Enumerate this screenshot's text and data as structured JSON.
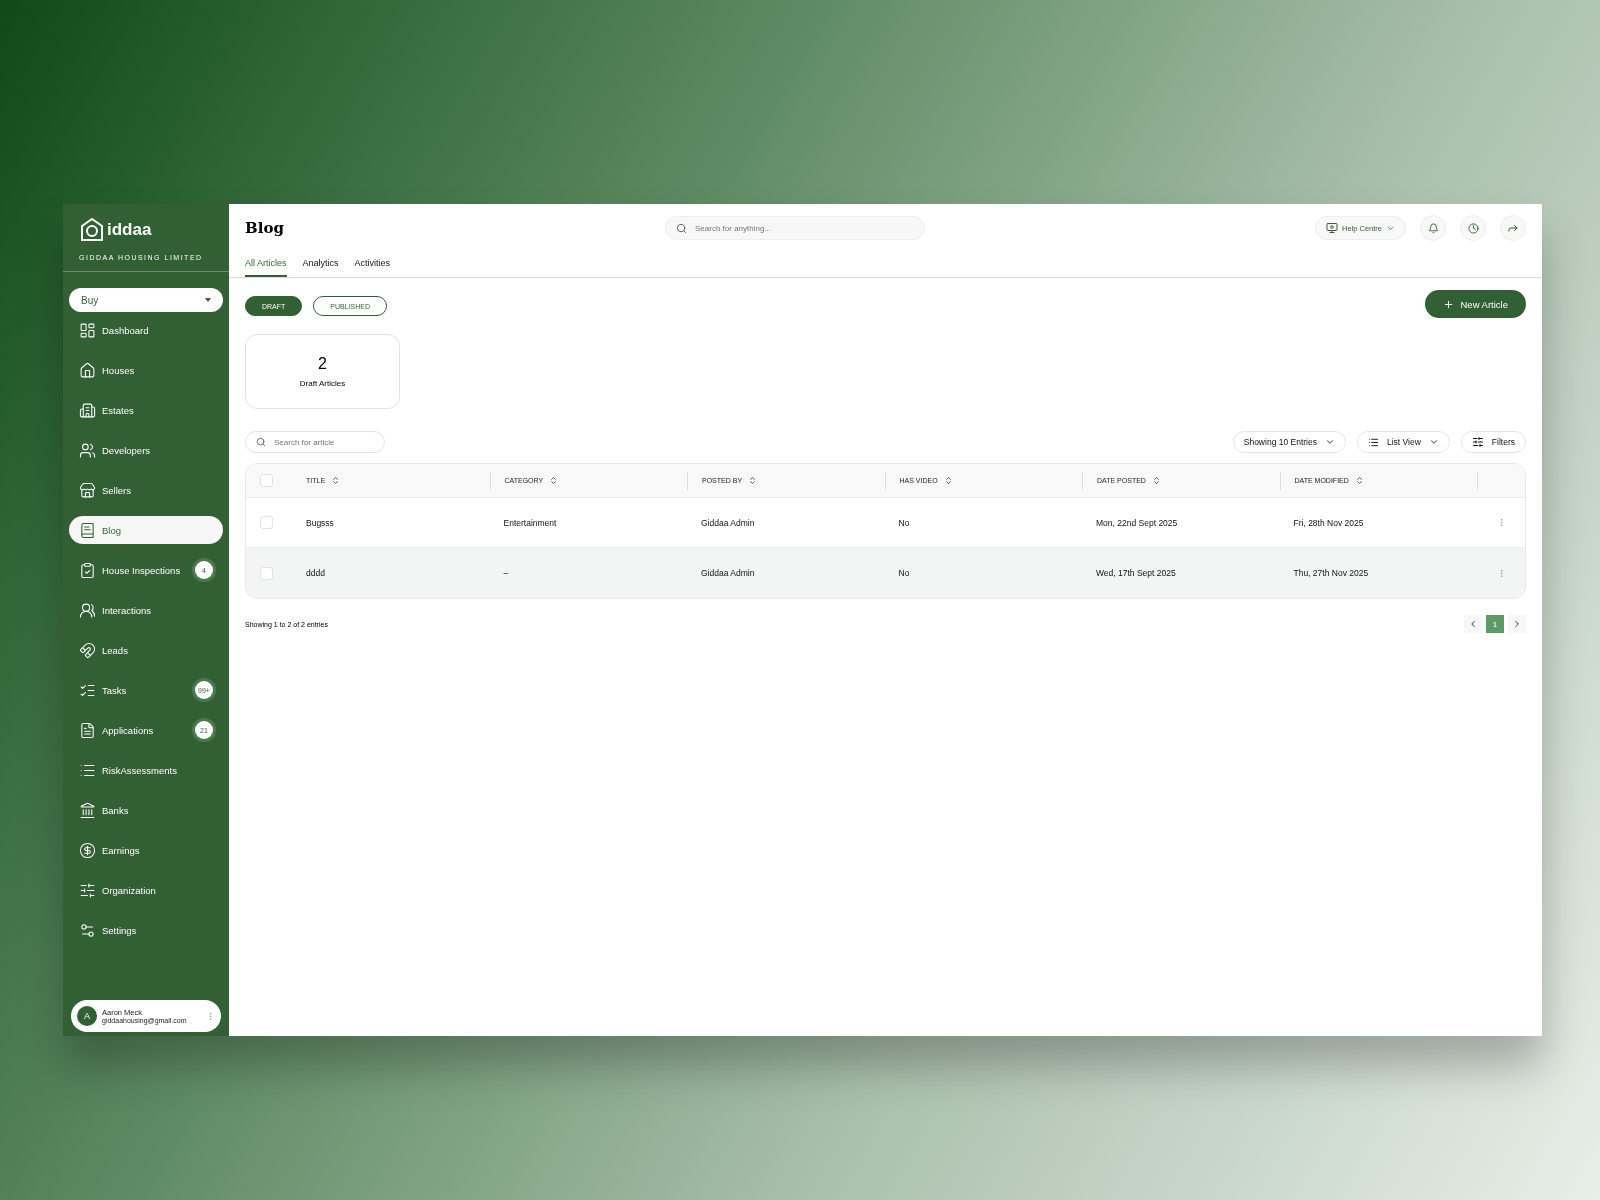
{
  "sidebar": {
    "logo": "iddaa",
    "company": "GIDDAA HOUSING LIMITED",
    "mode_select": {
      "value": "Buy"
    },
    "items": [
      {
        "label": "Dashboard",
        "selected": false
      },
      {
        "label": "Houses",
        "selected": false
      },
      {
        "label": "Estates",
        "selected": false
      },
      {
        "label": "Developers",
        "selected": false
      },
      {
        "label": "Sellers",
        "selected": false
      },
      {
        "label": "Blog",
        "selected": true
      },
      {
        "label": "House Inspections",
        "selected": false,
        "badge": "4"
      },
      {
        "label": "Interactions",
        "selected": false
      },
      {
        "label": "Leads",
        "selected": false
      },
      {
        "label": "Tasks",
        "selected": false,
        "badge": "99+"
      },
      {
        "label": "Applications",
        "selected": false,
        "badge": "21"
      },
      {
        "label": "RiskAssessments",
        "selected": false
      },
      {
        "label": "Banks",
        "selected": false
      },
      {
        "label": "Earnings",
        "selected": false
      },
      {
        "label": "Organization",
        "selected": false
      },
      {
        "label": "Settings",
        "selected": false
      }
    ],
    "user": {
      "initial": "A",
      "name": "Aaron Meck",
      "email": "giddaahousing@gmail.com"
    }
  },
  "header": {
    "title": "Blog",
    "search": {
      "placeholder": "Search for anything..."
    },
    "help": "Help Centre"
  },
  "tabs": [
    {
      "label": "All Articles",
      "selected": true
    },
    {
      "label": "Analytics",
      "selected": false
    },
    {
      "label": "Activities",
      "selected": false
    }
  ],
  "filters": [
    {
      "label": "DRAFT",
      "selected": true
    },
    {
      "label": "PUBLISHED",
      "selected": false
    }
  ],
  "new_button": "New Article",
  "stat": {
    "value": "2",
    "label": "Draft Articles"
  },
  "table_search": {
    "placeholder": "Search for article"
  },
  "entries": "Showing 10 Entries",
  "view": "List View",
  "filters_button": "Filters",
  "table": {
    "select_all": {
      "checked": false
    },
    "columns": [
      "TITLE",
      "CATEGORY",
      "POSTED BY",
      "HAS VIDEO",
      "DATE POSTED",
      "DATE MODIFIED"
    ],
    "rows": [
      {
        "selected": false,
        "checked": false,
        "cells": [
          "Bugsss",
          "Entertainment",
          "Giddaa Admin",
          "No",
          "Mon, 22nd Sept 2025",
          "Fri, 28th Nov 2025"
        ]
      },
      {
        "selected": true,
        "checked": false,
        "cells": [
          "dddd",
          "–",
          "Giddaa Admin",
          "No",
          "Wed, 17th Sept 2025",
          "Thu, 27th Nov 2025"
        ]
      }
    ]
  },
  "footer": {
    "summary": "Showing 1 to 2 of 2 entries",
    "pages": [
      {
        "label": "1",
        "selected": true
      }
    ]
  }
}
